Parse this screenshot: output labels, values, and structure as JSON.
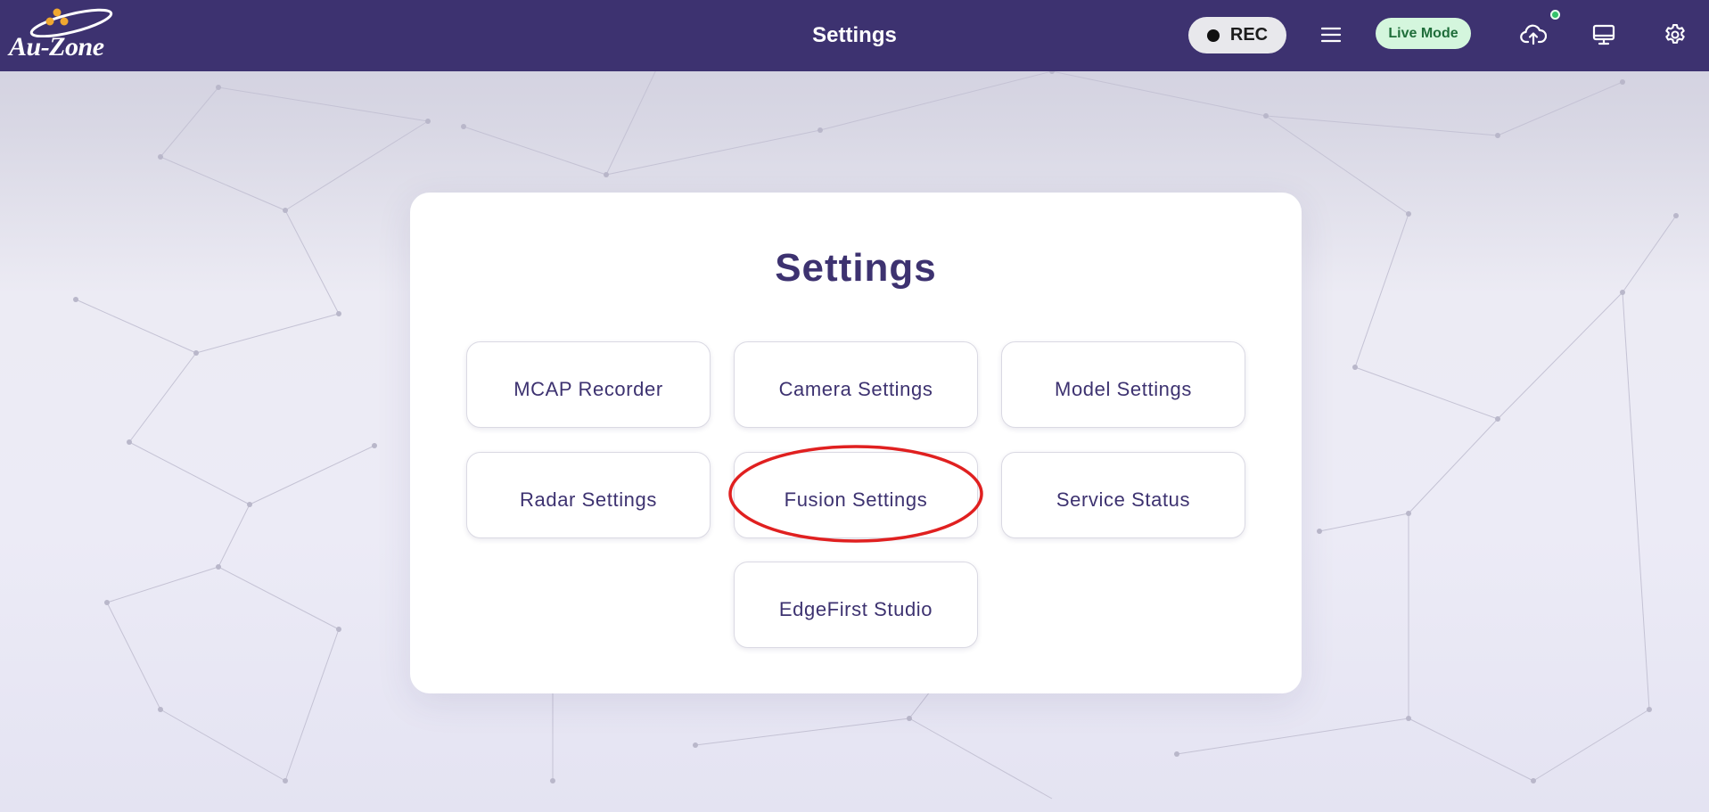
{
  "header": {
    "logo_text": "Au-Zone",
    "title": "Settings",
    "rec_label": "REC",
    "live_mode_label": "Live Mode",
    "icons": [
      "menu-icon",
      "cloud-upload-icon",
      "display-icon",
      "gear-icon"
    ]
  },
  "card": {
    "title": "Settings",
    "buttons": [
      {
        "label": "MCAP Recorder"
      },
      {
        "label": "Camera Settings"
      },
      {
        "label": "Model Settings"
      },
      {
        "label": "Radar Settings"
      },
      {
        "label": "Fusion Settings"
      },
      {
        "label": "Service Status"
      },
      {
        "label": "EdgeFirst Studio"
      }
    ]
  },
  "colors": {
    "header_bg": "#3d3270",
    "accent_text": "#3d3270",
    "live_badge_bg": "#d4f6dd",
    "live_badge_text": "#1f6e3a",
    "status_dot": "#33c26b",
    "annotation_circle": "#e02020"
  }
}
